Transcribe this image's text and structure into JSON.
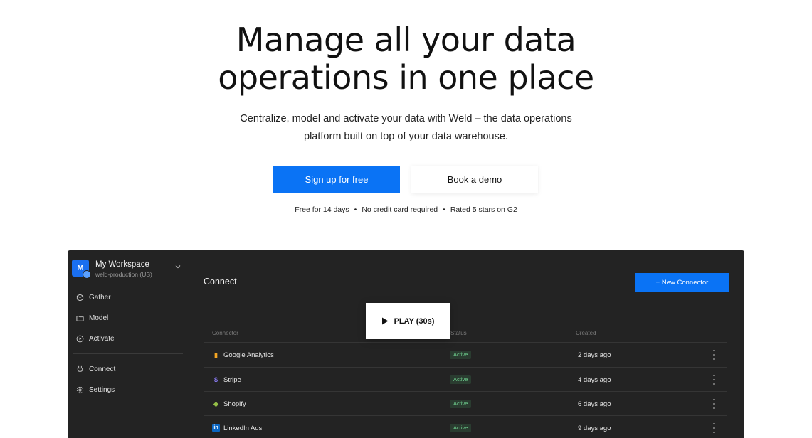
{
  "hero": {
    "title_line1": "Manage all your data",
    "title_line2": "operations in one place",
    "subtitle_line1": "Centralize, model and activate your data with Weld – the data operations",
    "subtitle_line2": "platform built on top of your data warehouse.",
    "primary_cta": "Sign up for free",
    "secondary_cta": "Book a demo",
    "perks": [
      "Free for 14 days",
      "No credit card required",
      "Rated 5 stars on G2"
    ]
  },
  "app": {
    "workspace": {
      "initial": "M",
      "name": "My Workspace",
      "sub": "weld-production (US)"
    },
    "nav": [
      {
        "label": "Gather",
        "icon": "cube-icon"
      },
      {
        "label": "Model",
        "icon": "folder-icon"
      },
      {
        "label": "Activate",
        "icon": "play-circle-icon"
      },
      {
        "label": "Connect",
        "icon": "plug-icon"
      },
      {
        "label": "Settings",
        "icon": "gear-icon"
      }
    ],
    "page_title": "Connect",
    "new_connector_label": "+ New Connector",
    "columns": [
      "Connector",
      "Status",
      "Created"
    ],
    "rows": [
      {
        "name": "Google Analytics",
        "icon": "google-analytics-icon",
        "status": "Active",
        "created": "2 days ago"
      },
      {
        "name": "Stripe",
        "icon": "stripe-icon",
        "status": "Active",
        "created": "4 days ago"
      },
      {
        "name": "Shopify",
        "icon": "shopify-icon",
        "status": "Active",
        "created": "6 days ago"
      },
      {
        "name": "LinkedIn Ads",
        "icon": "linkedin-icon",
        "status": "Active",
        "created": "9 days ago"
      }
    ]
  },
  "video": {
    "play_label": "PLAY (30s)"
  },
  "colors": {
    "accent": "#0a73f5",
    "app_bg": "#232323",
    "status_active": "#6fcf8e"
  }
}
